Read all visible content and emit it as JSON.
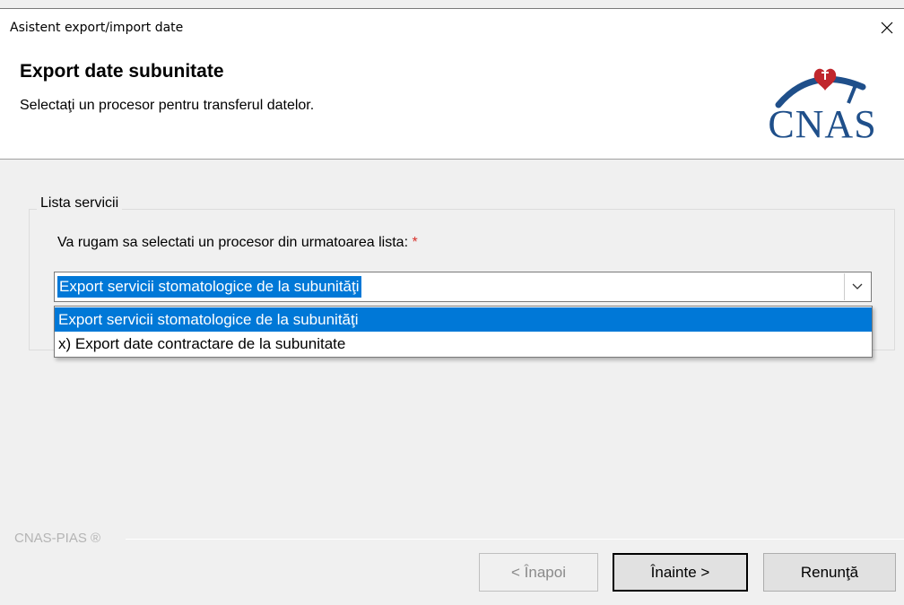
{
  "window": {
    "title": "Asistent export/import date",
    "close_icon": "close-icon"
  },
  "header": {
    "title": "Export date subunitate",
    "subtitle": "Selectaţi un procesor pentru transferul datelor.",
    "logo_text": "CNAS"
  },
  "group": {
    "legend": "Lista servicii",
    "prompt": "Va rugam sa selectati un procesor din urmatoarea lista:",
    "required_marker": "*"
  },
  "combo": {
    "selected_value": "Export servicii stomatologice de la subunităţi",
    "options": [
      "Export servicii stomatologice de la subunităţi",
      "x) Export date contractare de la subunitate"
    ]
  },
  "footer": {
    "brand": "CNAS-PIAS ®"
  },
  "buttons": {
    "back": "< Înapoi",
    "next": "Înainte >",
    "cancel": "Renunţă"
  },
  "colors": {
    "accent": "#0078d7",
    "required": "#d8302a",
    "logo": "#1f4f8a"
  }
}
